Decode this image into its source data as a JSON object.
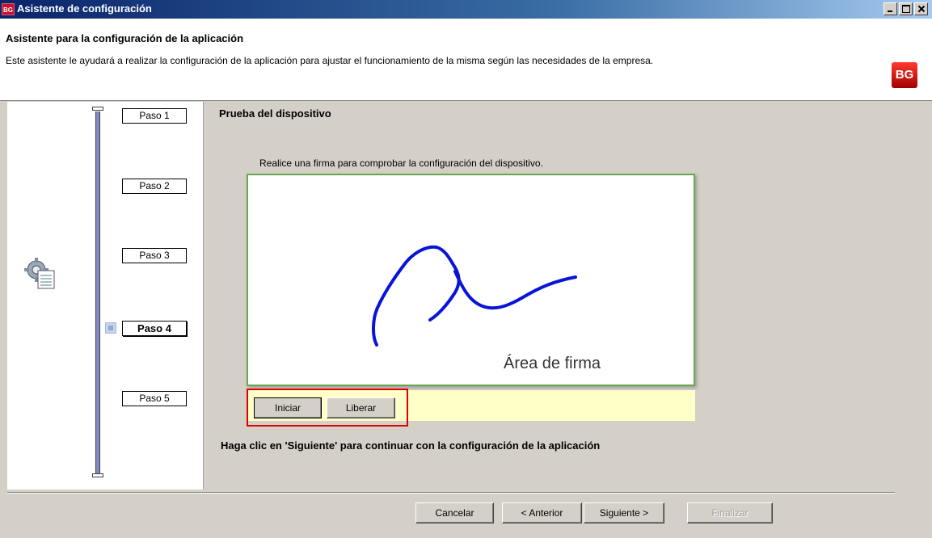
{
  "window": {
    "title": "Asistente de configuración",
    "app_icon_text": "BG"
  },
  "header": {
    "title": "Asistente para la configuración de la aplicación",
    "description": "Este asistente le ayudará a realizar la configuración de la aplicación para ajustar el funcionamiento de la misma según las necesidades de la empresa.",
    "logo_text": "BG"
  },
  "steps": [
    "Paso 1",
    "Paso 2",
    "Paso 3",
    "Paso 4",
    "Paso 5"
  ],
  "current_step": "Paso 4",
  "content": {
    "section_title": "Prueba del dispositivo",
    "instruction": "Realice una firma para comprobar la configuración del dispositivo.",
    "signature_area_label": "Área de firma",
    "start_button": "Iniciar",
    "release_button": "Liberar",
    "continue_text": "Haga clic en 'Siguiente' para continuar con la configuración de la aplicación"
  },
  "footer": {
    "cancel": "Cancelar",
    "back": "< Anterior",
    "next": "Siguiente >",
    "finish": "Finalizar"
  },
  "colors": {
    "signature_stroke": "#0a14d8",
    "signature_border": "#6aa84f",
    "highlight_border": "#e00000"
  },
  "icons": [
    "app-icon",
    "brand-logo",
    "wizard-gear-icon"
  ]
}
